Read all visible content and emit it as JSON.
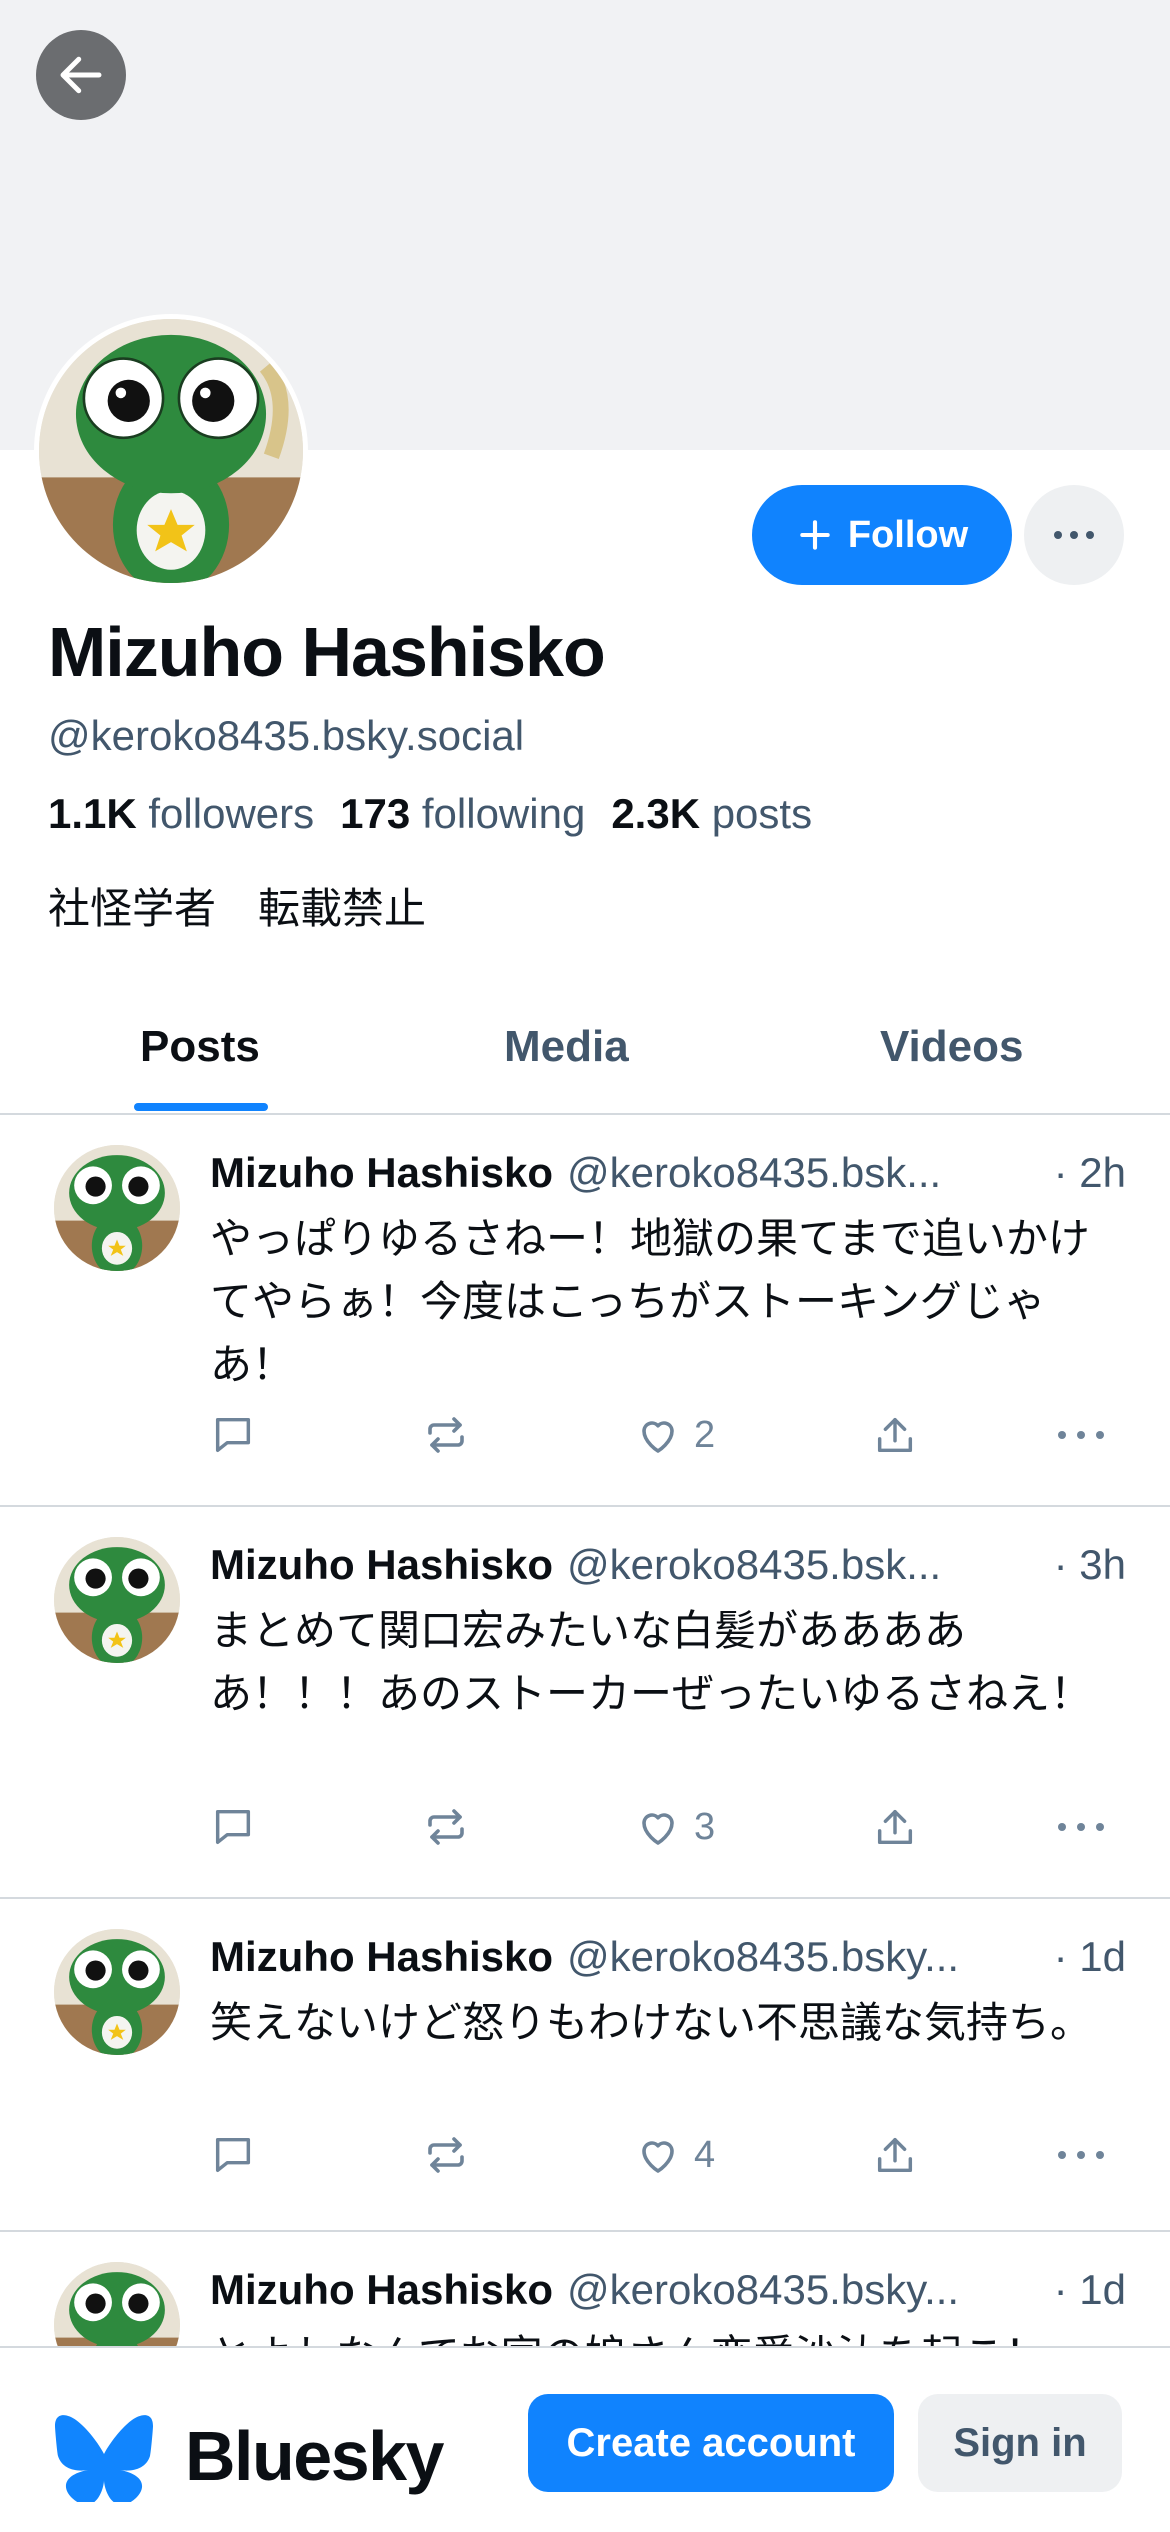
{
  "header": {
    "back_icon": "arrow-left-icon"
  },
  "profile": {
    "display_name": "Mizuho Hashisko",
    "handle": "@keroko8435.bsky.social",
    "followers_count": "1.1K",
    "followers_label": "followers",
    "following_count": "173",
    "following_label": "following",
    "posts_count": "2.3K",
    "posts_label": "posts",
    "bio": "社怪学者　転載禁止",
    "follow_label": "Follow",
    "more_icon": "ellipsis-icon"
  },
  "tabs": [
    {
      "label": "Posts",
      "active": true
    },
    {
      "label": "Media",
      "active": false
    },
    {
      "label": "Videos",
      "active": false
    }
  ],
  "posts": [
    {
      "author": "Mizuho Hashisko",
      "handle": "@keroko8435.bsk...",
      "time": "· 2h",
      "text": "やっぱりゆるさねー！地獄の果てまで追いかけてやらぁ！今度はこっちがストーキングじゃあ！",
      "likes": "2"
    },
    {
      "author": "Mizuho Hashisko",
      "handle": "@keroko8435.bsk...",
      "time": "· 3h",
      "text": "まとめて関口宏みたいな白髪があああああ！！！あのストーカーぜったいゆるさねえ！",
      "likes": "3"
    },
    {
      "author": "Mizuho Hashisko",
      "handle": "@keroko8435.bsky...",
      "time": "· 1d",
      "text": "笑えないけど怒りもわけない不思議な気持ち。",
      "likes": "4"
    },
    {
      "author": "Mizuho Hashisko",
      "handle": "@keroko8435.bsky...",
      "time": "· 1d",
      "text": "とよしなんてお宮の娘さん恋愛沙汰を起こ！",
      "likes": ""
    }
  ],
  "bottom_bar": {
    "brand": "Bluesky",
    "create_account": "Create account",
    "sign_in": "Sign in"
  },
  "colors": {
    "accent": "#1083fe",
    "muted_text": "#42576c",
    "banner": "#f1f2f4"
  }
}
